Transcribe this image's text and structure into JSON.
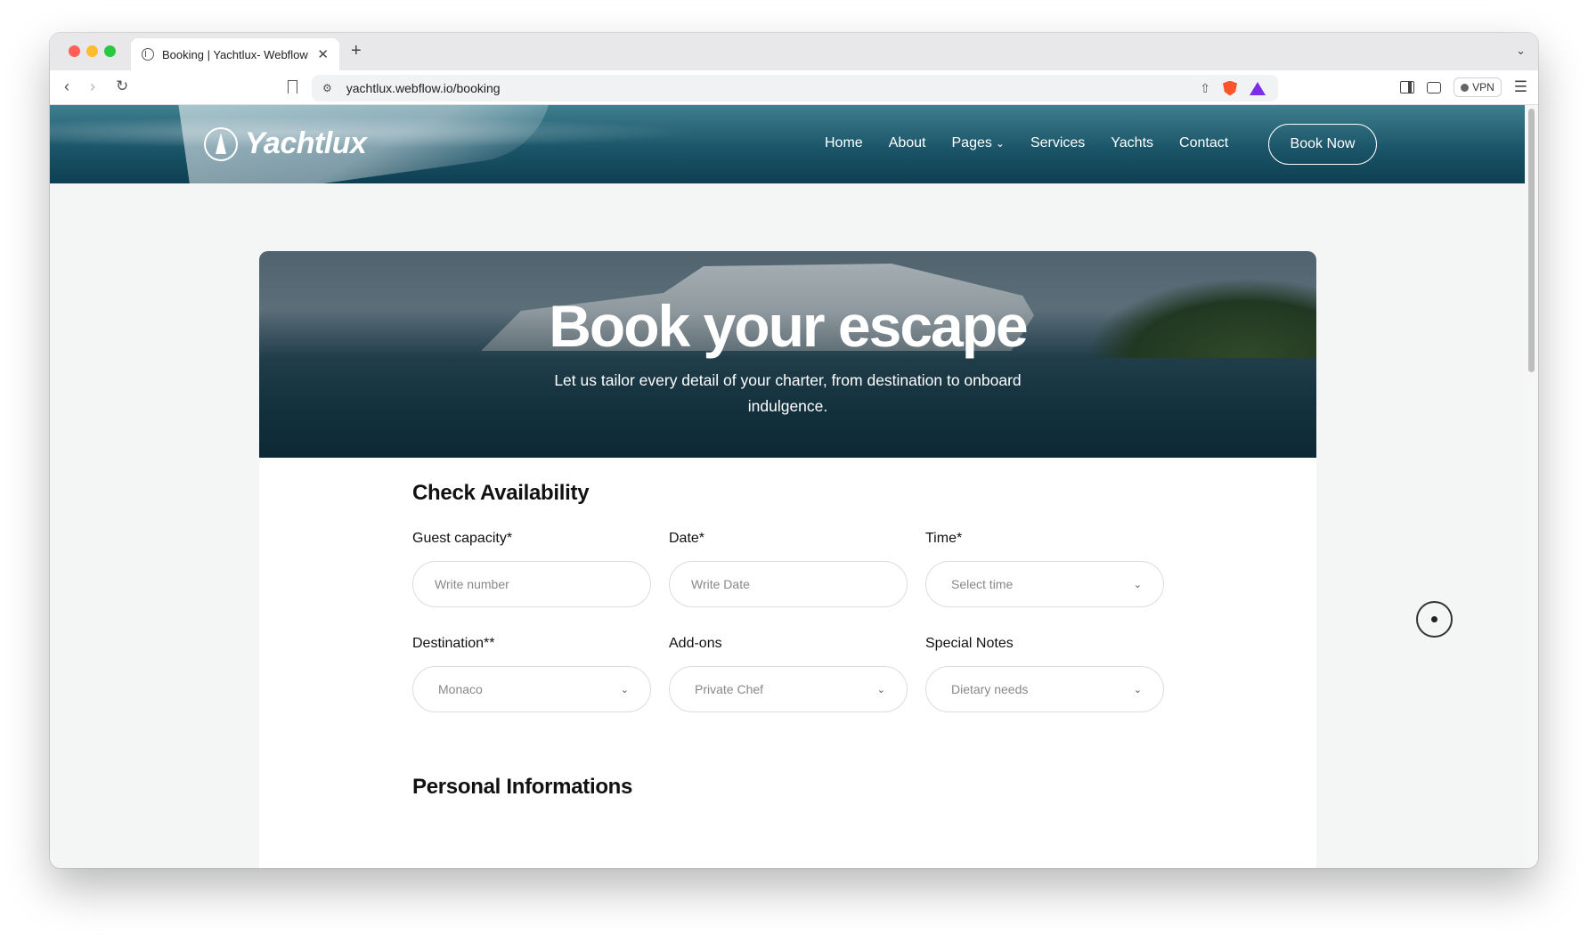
{
  "browser": {
    "tab_title": "Booking | Yachtlux- Webflow",
    "tab_close": "✕",
    "new_tab": "+",
    "url": "yachtlux.webflow.io/booking",
    "vpn_label": "VPN"
  },
  "site": {
    "logo_text": "Yachtlux",
    "nav": [
      "Home",
      "About",
      "Pages",
      "Services",
      "Yachts",
      "Contact"
    ],
    "cta_label": "Book Now"
  },
  "hero": {
    "title": "Book your escape",
    "subtitle": "Let us tailor every detail of your charter, from destination to onboard indulgence."
  },
  "availability": {
    "title": "Check Availability",
    "fields": [
      {
        "label": "Guest capacity*",
        "placeholder": "Write number"
      },
      {
        "label": "Date*",
        "placeholder": "Write Date"
      },
      {
        "label": "Time*",
        "value": "Select time"
      },
      {
        "label": "Destination**",
        "value": "Monaco"
      },
      {
        "label": "Add-ons",
        "value": "Private Chef"
      },
      {
        "label": "Special Notes",
        "value": "Dietary needs"
      }
    ]
  },
  "personal": {
    "title": "Personal Informations"
  },
  "icons": {
    "back": "chevron-left-icon",
    "forward": "chevron-right-icon",
    "reload": "reload-icon",
    "menu": "hamburger-menu-icon"
  }
}
